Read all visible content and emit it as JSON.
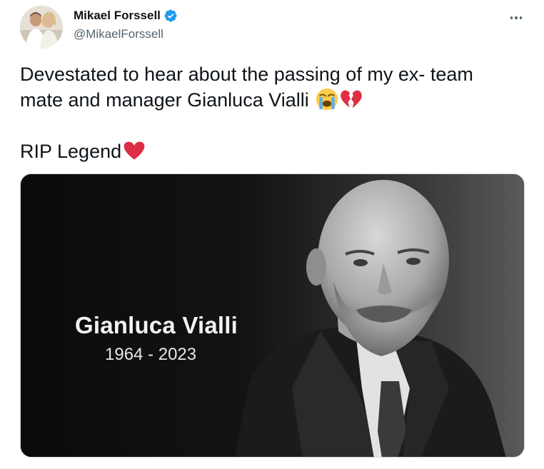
{
  "author": {
    "display_name": "Mikael Forssell",
    "handle": "@MikaelForssell",
    "verified": true
  },
  "icons": {
    "verified": "verified-badge-icon",
    "more": "more-dots-icon",
    "crying": "loudly-crying-face-emoji",
    "broken_heart": "broken-heart-emoji",
    "heart": "red-heart-emoji"
  },
  "tweet": {
    "line1": "Devestated to hear about the passing of my ex- team",
    "line2": "mate and manager Gianluca Vialli ",
    "line3": "RIP Legend"
  },
  "media": {
    "name": "Gianluca Vialli",
    "years": "1964 - 2023"
  },
  "colors": {
    "verified_blue": "#1d9bf0",
    "heart_red": "#dd2e44",
    "muted_text": "#536471"
  }
}
